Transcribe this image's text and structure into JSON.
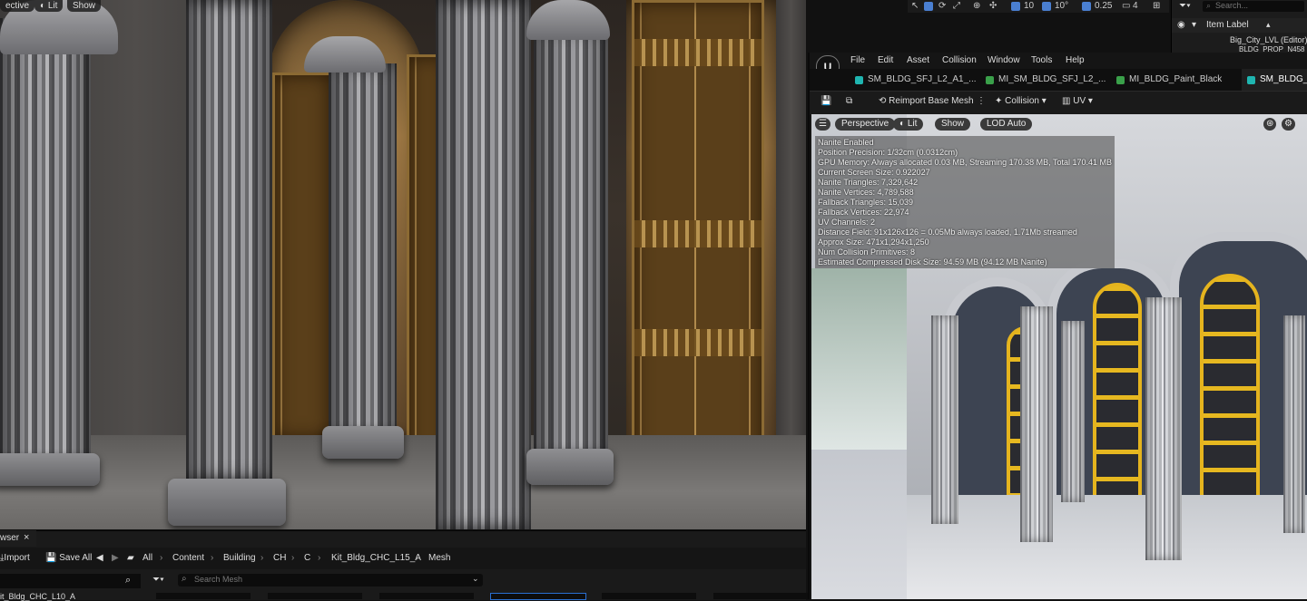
{
  "main_viewport": {
    "view_mode_partial": "ective",
    "lit_label": "Lit",
    "show_label": "Show"
  },
  "top_tools": {
    "grid_snap": "10",
    "angle_snap": "10°",
    "scale_snap": "0.25",
    "camera_speed": "4"
  },
  "outliner": {
    "search_placeholder": "Search...",
    "column_label": "Item Label",
    "sort_arrow": "▴",
    "rows": [
      "Big_City_LVL (Editor)",
      "BLDG_PROP_N458"
    ]
  },
  "editor": {
    "menu": [
      "File",
      "Edit",
      "Asset",
      "Collision",
      "Window",
      "Tools",
      "Help"
    ],
    "tabs": [
      {
        "label": "SM_BLDG_SFJ_L2_A1_...",
        "color": "#1fb5b0"
      },
      {
        "label": "MI_SM_BLDG_SFJ_L2_...",
        "color": "#3aa04a"
      },
      {
        "label": "MI_BLDG_Paint_Black",
        "color": "#3aa04a"
      },
      {
        "label": "SM_BLDG_SF",
        "color": "#1fb5b0"
      }
    ],
    "toolbar": {
      "reimport_label": "Reimport Base Mesh",
      "collision_label": "Collision",
      "uv_label": "UV"
    },
    "viewport": {
      "perspective_label": "Perspective",
      "lit_label": "Lit",
      "show_label": "Show",
      "lod_label": "LOD Auto"
    },
    "stats": [
      "Nanite Enabled",
      "Position Precision: 1/32cm (0.0312cm)",
      "GPU Memory: Always allocated 0.03 MB, Streaming 170.38 MB, Total 170.41 MB",
      "Current Screen Size: 0.922027",
      "Nanite Triangles: 7,329,642",
      "Nanite Vertices: 4,789,588",
      "Fallback Triangles: 15,039",
      "Fallback Vertices: 22,974",
      "UV Channels: 2",
      "Distance Field: 91x126x126 = 0.05Mb always loaded, 1.71Mb streamed",
      "Approx Size: 471x1,294x1,250",
      "Num Collision Primitives: 8",
      "Estimated Compressed Disk Size: 94.59 MB (94.12 MB Nanite)"
    ]
  },
  "content_browser": {
    "tab_label": "wser",
    "close_glyph": "×",
    "import_label": "Import",
    "save_all_label": "Save All",
    "breadcrumb": [
      "All",
      "Content",
      "Building",
      "CH",
      "C",
      "Kit_Bldg_CHC_L15_A",
      "Mesh"
    ],
    "search_placeholder": "Search Mesh",
    "tree_item": "it_Bldg_CHC_L10_A"
  }
}
